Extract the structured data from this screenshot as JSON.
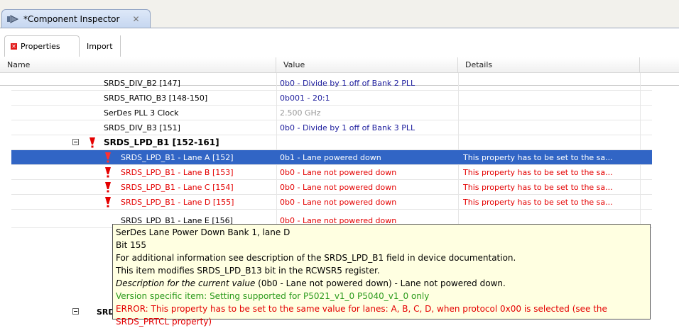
{
  "editor": {
    "tab_title": "*Component Inspector",
    "close_glyph": "✕"
  },
  "subtabs": {
    "properties": "Properties",
    "import": "Import"
  },
  "columns": {
    "name": "Name",
    "value": "Value",
    "details": "Details"
  },
  "rows": [
    {
      "name": "SRDS_DIV_B2  [147]",
      "value": "0b0 - Divide by 1 off of Bank 2 PLL",
      "details": ""
    },
    {
      "name": "SRDS_RATIO_B3  [148-150]",
      "value": "0b001 - 20:1",
      "details": ""
    },
    {
      "name": "SerDes PLL 3 Clock",
      "value": "2.500 GHz",
      "details": ""
    },
    {
      "name": "SRDS_DIV_B3  [151]",
      "value": "0b0 - Divide by 1 off of Bank 3 PLL",
      "details": ""
    },
    {
      "name": "SRDS_LPD_B1  [152-161]",
      "value": "",
      "details": ""
    },
    {
      "name": "SRDS_LPD_B1 - Lane A  [152]",
      "value": "0b1 - Lane powered down",
      "details": "This property has to be set to the sa..."
    },
    {
      "name": "SRDS_LPD_B1 - Lane B  [153]",
      "value": "0b0 - Lane not powered down",
      "details": "This property has to be set to the sa..."
    },
    {
      "name": "SRDS_LPD_B1 - Lane C  [154]",
      "value": "0b0 - Lane not powered down",
      "details": "This property has to be set to the sa..."
    },
    {
      "name": "SRDS_LPD_B1 - Lane D  [155]",
      "value": "0b0 - Lane not powered down",
      "details": "This property has to be set to the sa..."
    },
    {
      "name": "SRDS_LPD_B1 - Lane E  [156]",
      "value": "0b0 - Lane not powered down",
      "details": ""
    },
    {
      "name": "SRDS",
      "value": "",
      "details": ""
    }
  ],
  "tooltip": {
    "l1": "SerDes Lane Power Down Bank 1, lane D",
    "l2": "Bit 155",
    "l3": "For additional information see description of the SRDS_LPD_B1 field in device documentation.",
    "l4": "This item modifies SRDS_LPD_B13 bit in the RCWSR5 register.",
    "l5_italic": "Description for the current value",
    "l5_rest": " (0b0 - Lane not powered down) - Lane not powered down.",
    "l6": "Version specific item: Setting supported for P5021_v1_0 P5040_v1_0 only",
    "l7": "ERROR: This property has to be set to the same value for lanes: A, B, C, D, when protocol 0x00 is selected (see the",
    "l8": "SRDS_PRTCL property)"
  },
  "colors": {
    "selection": "#3165c5",
    "error": "#e40000",
    "value_text": "#1a1a9c",
    "tooltip_bg": "#ffffe1",
    "tooltip_green": "#2a9a1a"
  }
}
